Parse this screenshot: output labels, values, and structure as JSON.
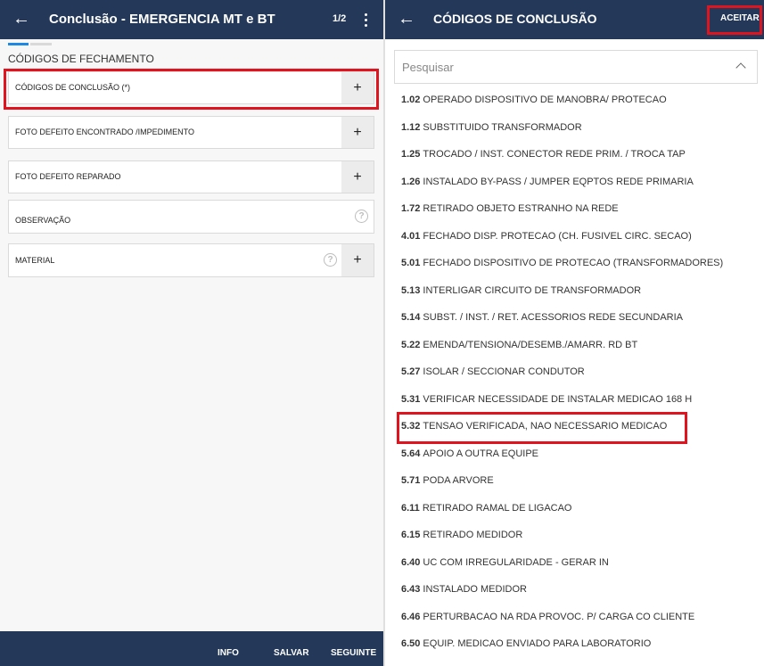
{
  "left": {
    "title": "Conclusão - EMERGENCIA MT e BT",
    "pager": "1/2",
    "section_title": "CÓDIGOS DE FECHAMENTO",
    "fields": [
      {
        "label": "CÓDIGOS DE CONCLUSÃO (*)",
        "action": "+"
      },
      {
        "label": "FOTO DEFEITO ENCONTRADO /IMPEDIMENTO",
        "action": "+"
      },
      {
        "label": "FOTO DEFEITO REPARADO",
        "action": "+"
      },
      {
        "label": "OBSERVAÇÃO",
        "help": "?"
      },
      {
        "label": "MATERIAL",
        "help": "?",
        "action": "+"
      }
    ],
    "bottom": {
      "info": "INFO",
      "save": "SALVAR",
      "next": "SEGUINTE"
    }
  },
  "right": {
    "title": "CÓDIGOS DE CONCLUSÃO",
    "accept_label": "ACEITAR",
    "search": {
      "placeholder": "Pesquisar"
    },
    "items": [
      {
        "code": "1.02",
        "text": "OPERADO DISPOSITIVO DE MANOBRA/ PROTECAO"
      },
      {
        "code": "1.12",
        "text": "SUBSTITUIDO TRANSFORMADOR"
      },
      {
        "code": "1.25",
        "text": "TROCADO / INST. CONECTOR REDE PRIM. / TROCA TAP"
      },
      {
        "code": "1.26",
        "text": "INSTALADO BY-PASS / JUMPER EQPTOS REDE PRIMARIA"
      },
      {
        "code": "1.72",
        "text": "RETIRADO OBJETO ESTRANHO NA REDE"
      },
      {
        "code": "4.01",
        "text": "FECHADO DISP. PROTECAO (CH. FUSIVEL CIRC. SECAO)"
      },
      {
        "code": "5.01",
        "text": "FECHADO DISPOSITIVO DE PROTECAO (TRANSFORMADORES)"
      },
      {
        "code": "5.13",
        "text": "INTERLIGAR CIRCUITO DE TRANSFORMADOR"
      },
      {
        "code": "5.14",
        "text": "SUBST. / INST. / RET. ACESSORIOS REDE SECUNDARIA"
      },
      {
        "code": "5.22",
        "text": "EMENDA/TENSIONA/DESEMB./AMARR. RD BT"
      },
      {
        "code": "5.27",
        "text": "ISOLAR / SECCIONAR CONDUTOR"
      },
      {
        "code": "5.31",
        "text": "VERIFICAR NECESSIDADE DE INSTALAR MEDICAO 168 H"
      },
      {
        "code": "5.32",
        "text": "TENSAO VERIFICADA, NAO NECESSARIO MEDICAO"
      },
      {
        "code": "5.64",
        "text": "APOIO A OUTRA EQUIPE"
      },
      {
        "code": "5.71",
        "text": "PODA ARVORE"
      },
      {
        "code": "6.11",
        "text": "RETIRADO RAMAL DE LIGACAO"
      },
      {
        "code": "6.15",
        "text": "RETIRADO MEDIDOR"
      },
      {
        "code": "6.40",
        "text": "UC COM IRREGULARIDADE - GERAR IN"
      },
      {
        "code": "6.43",
        "text": "INSTALADO MEDIDOR"
      },
      {
        "code": "6.46",
        "text": "PERTURBACAO NA RDA PROVOC. P/ CARGA CO CLIENTE"
      },
      {
        "code": "6.50",
        "text": "EQUIP. MEDICAO ENVIADO PARA LABORATORIO"
      }
    ]
  },
  "colors": {
    "header": "#24395a",
    "highlight": "#e0141e",
    "tab_active": "#1e88e5"
  },
  "icons": {
    "back": "arrow-left-icon",
    "menu": "more-vert-icon",
    "add": "plus-icon",
    "help": "help-circle-icon",
    "collapse": "chevron-up-icon"
  }
}
